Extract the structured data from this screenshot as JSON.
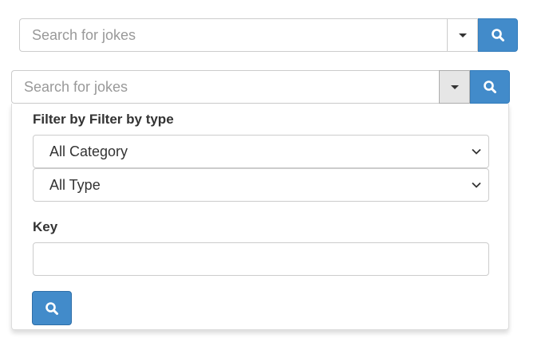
{
  "search_bar_1": {
    "placeholder": "Search for jokes",
    "toggle_icon": "caret-down-icon",
    "submit_icon": "search-icon"
  },
  "search_bar_2": {
    "placeholder": "Search for jokes",
    "toggle_icon": "caret-down-icon",
    "toggle_state": "open",
    "submit_icon": "search-icon"
  },
  "filter_panel": {
    "heading": "Filter by Filter by type",
    "category_select": {
      "selected": "All Category",
      "icon": "chevron-down-icon"
    },
    "type_select": {
      "selected": "All Type",
      "icon": "chevron-down-icon"
    },
    "key_label": "Key",
    "key_value": "",
    "search_button_icon": "search-icon"
  },
  "colors": {
    "primary_button": "#428bca",
    "active_toggle": "#e6e6e6",
    "border": "#cccccc",
    "placeholder_text": "#999999",
    "text": "#333333"
  }
}
